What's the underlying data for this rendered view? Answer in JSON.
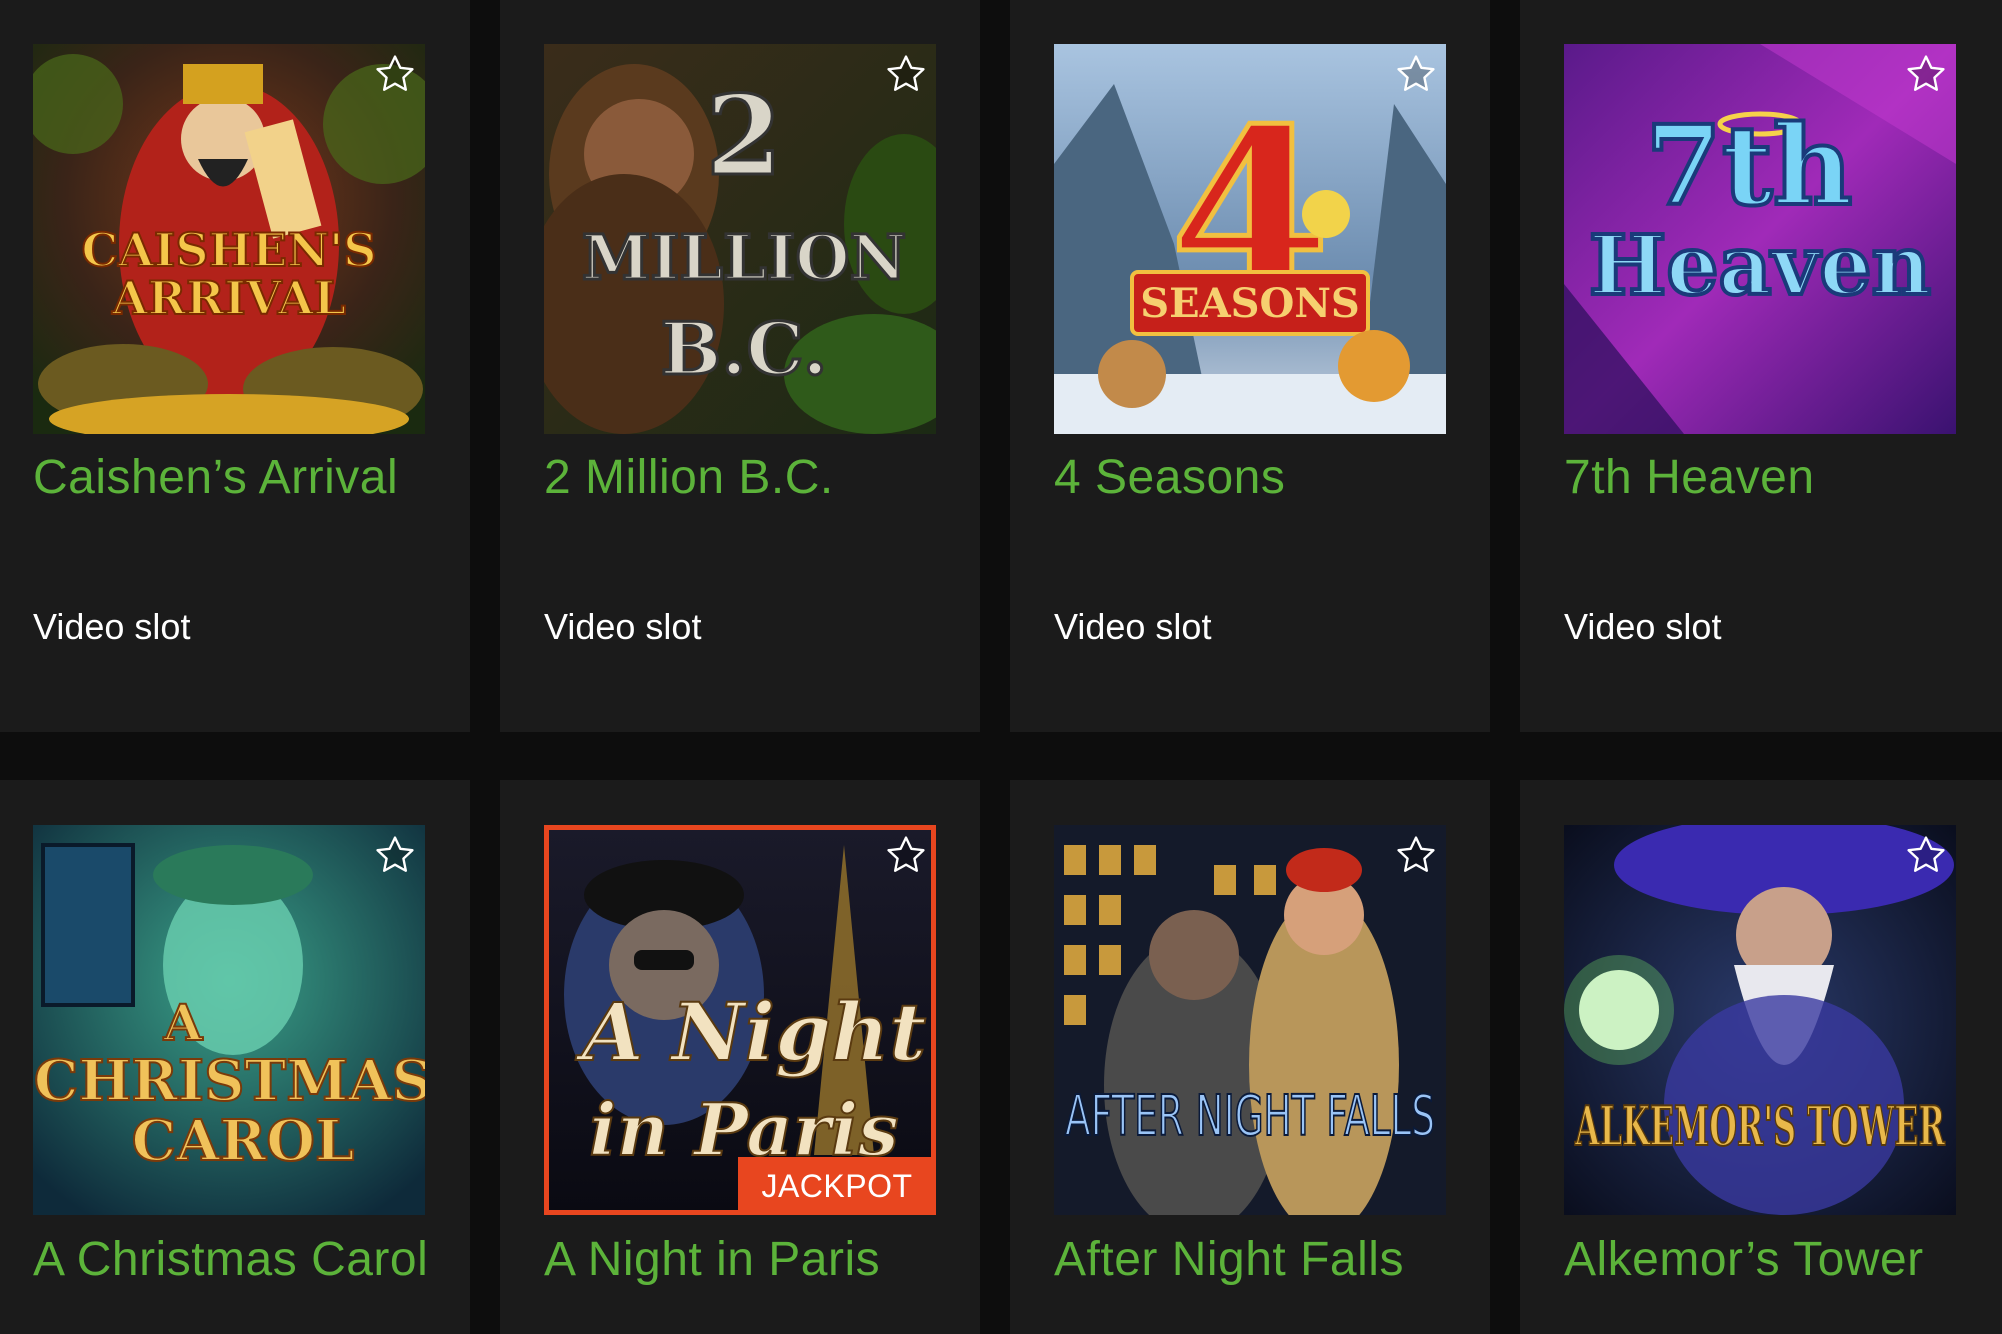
{
  "games": [
    {
      "title": "Caishen’s Arrival",
      "type": "Video slot",
      "art_text": [
        "CAISHEN'S",
        "ARRIVAL"
      ],
      "favorite_icon": "star-outline-icon"
    },
    {
      "title": "2 Million B.C.",
      "type": "Video slot",
      "art_text": [
        "2",
        "MILLION",
        "B.C."
      ],
      "favorite_icon": "star-outline-icon"
    },
    {
      "title": "4 Seasons",
      "type": "Video slot",
      "art_text": [
        "4",
        "SEASONS"
      ],
      "favorite_icon": "star-outline-icon"
    },
    {
      "title": "7th Heaven",
      "type": "Video slot",
      "art_text": [
        "7th",
        "Heaven"
      ],
      "favorite_icon": "star-outline-icon"
    },
    {
      "title": "A Christmas Carol",
      "art_text": [
        "A",
        "CHRISTMAS",
        "CAROL"
      ],
      "favorite_icon": "star-outline-icon"
    },
    {
      "title": "A Night in Paris",
      "badge": "JACKPOT",
      "art_text": [
        "A Night",
        "in Paris"
      ],
      "favorite_icon": "star-outline-icon"
    },
    {
      "title": "After Night Falls",
      "art_text": [
        "AFTER NIGHT FALLS"
      ],
      "favorite_icon": "star-outline-icon"
    },
    {
      "title": "Alkemor’s Tower",
      "art_text": [
        "ALKEMOR'S TOWER"
      ],
      "favorite_icon": "star-outline-icon"
    }
  ],
  "colors": {
    "page_bg": "#0d0d0d",
    "card_bg": "#1b1b1b",
    "title_green": "#5cb33a",
    "jackpot_red": "#e8461f"
  }
}
